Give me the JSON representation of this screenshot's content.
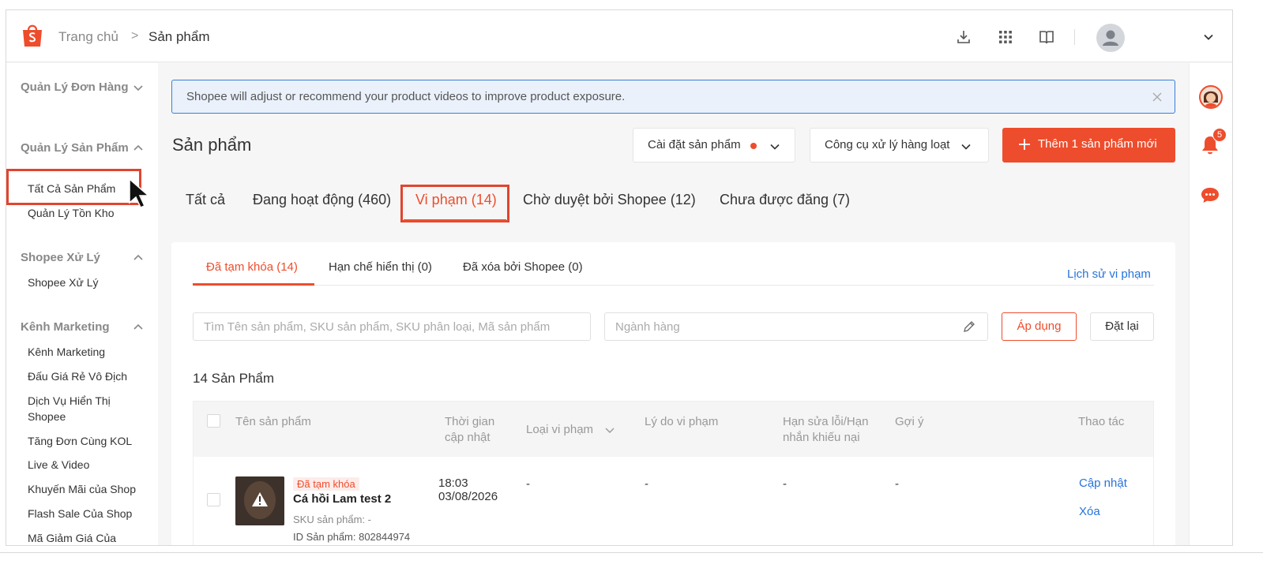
{
  "header": {
    "breadcrumb_home": "Trang chủ",
    "breadcrumb_separator": ">",
    "breadcrumb_current": "Sản phẩm",
    "icons": [
      "download-icon",
      "apps-grid-icon",
      "book-icon",
      "avatar",
      "chevron-down-icon"
    ]
  },
  "sidebar": {
    "groups": [
      {
        "label": "Quản Lý Đơn Hàng",
        "expanded": false
      },
      {
        "label": "Quản Lý Sản Phẩm",
        "expanded": true,
        "items": [
          "Tất Cả Sản Phẩm",
          "Quản Lý Tồn Kho"
        ]
      },
      {
        "label": "Shopee Xử Lý",
        "expanded": true,
        "items": [
          "Shopee Xử Lý"
        ]
      },
      {
        "label": "Kênh Marketing",
        "expanded": true,
        "items": [
          "Kênh Marketing",
          "Đấu Giá Rẻ Vô Địch",
          "Dịch Vụ Hiển Thị Shopee",
          "Tăng Đơn Cùng KOL",
          "Live & Video",
          "Khuyến Mãi của Shop",
          "Flash Sale Của Shop",
          "Mã Giảm Giá Của"
        ]
      }
    ],
    "highlighted_item": "Tất Cả Sản Phẩm"
  },
  "rightbar": {
    "notification_count": "5"
  },
  "banner": {
    "text": "Shopee will adjust or recommend your product videos to improve product exposure."
  },
  "main": {
    "title": "Sản phẩm",
    "settings_button": "Cài đặt sản phẩm",
    "bulk_tools_button": "Công cụ xử lý hàng loạt",
    "add_button": "Thêm 1 sản phẩm mới",
    "tabs": [
      {
        "label": "Tất cả",
        "active": false
      },
      {
        "label": "Đang hoạt động (460)",
        "active": false
      },
      {
        "label": "Vi phạm (14)",
        "active": true
      },
      {
        "label": "Chờ duyệt bởi Shopee (12)",
        "active": false
      },
      {
        "label": "Chưa được đăng (7)",
        "active": false
      }
    ],
    "subtabs": [
      {
        "label": "Đã tạm khóa (14)",
        "active": true
      },
      {
        "label": "Hạn chế hiển thị (0)",
        "active": false
      },
      {
        "label": "Đã xóa bởi Shopee (0)",
        "active": false
      }
    ],
    "history_link": "Lịch sử vi phạm",
    "search_placeholder": "Tìm Tên sản phẩm, SKU sản phẩm, SKU phân loại, Mã sản phẩm",
    "category_placeholder": "Ngành hàng",
    "apply_button": "Áp dụng",
    "reset_button": "Đặt lại",
    "count_label": "14 Sản Phẩm",
    "table": {
      "headers": {
        "name": "Tên sản phẩm",
        "updated_line1": "Thời gian",
        "updated_line2": "cập nhật",
        "violation_type": "Loại vi phạm",
        "reason": "Lý do vi phạm",
        "deadline_line1": "Hạn sửa lỗi/Hạn",
        "deadline_line2": "nhắn khiếu nại",
        "suggestion": "Gợi ý",
        "actions": "Thao tác"
      },
      "rows": [
        {
          "status": "Đã tạm khóa",
          "name": "Cá hồi Lam test 2",
          "sku": "SKU sản phẩm: -",
          "product_id": "ID Sản phẩm: 802844974",
          "time": "18:03",
          "date": "03/08/2026",
          "violation_type": "-",
          "reason": "-",
          "deadline": "-",
          "suggestion": "-",
          "action_update": "Cập nhật",
          "action_delete": "Xóa"
        }
      ]
    }
  },
  "colors": {
    "brand": "#ee4d2d",
    "link": "#2673dd",
    "highlight_box": "#e0452f",
    "banner_bg": "#eaf1fb"
  }
}
